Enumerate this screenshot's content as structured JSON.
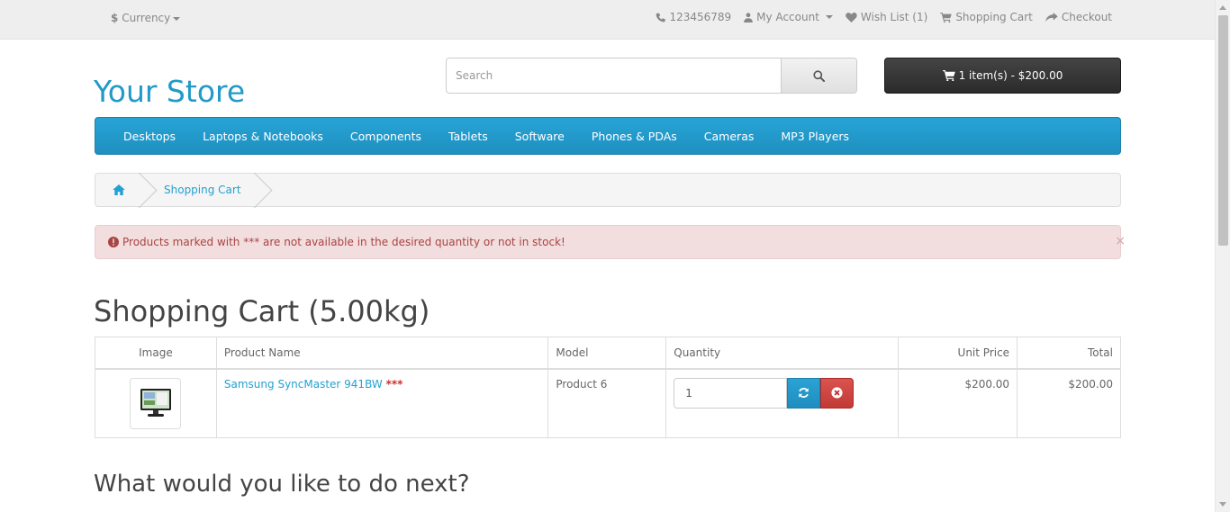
{
  "topbar": {
    "currency_symbol": "$",
    "currency_label": "Currency",
    "phone": "123456789",
    "my_account": "My Account",
    "wish_list": "Wish List (1)",
    "shopping_cart": "Shopping Cart",
    "checkout": "Checkout"
  },
  "header": {
    "logo": "Your Store",
    "search_placeholder": "Search",
    "cart_button": "1 item(s) - $200.00"
  },
  "menu": {
    "items": [
      "Desktops",
      "Laptops & Notebooks",
      "Components",
      "Tablets",
      "Software",
      "Phones & PDAs",
      "Cameras",
      "MP3 Players"
    ]
  },
  "breadcrumb": {
    "current": "Shopping Cart"
  },
  "alert": {
    "text": "Products marked with *** are not available in the desired quantity or not in stock!",
    "close": "×"
  },
  "page": {
    "title": "Shopping Cart  (5.00kg)",
    "next_heading": "What would you like to do next?"
  },
  "cart_table": {
    "headers": [
      "Image",
      "Product Name",
      "Model",
      "Quantity",
      "Unit Price",
      "Total"
    ],
    "rows": [
      {
        "product_name": "Samsung SyncMaster 941BW",
        "stock_flag": "***",
        "model": "Product 6",
        "quantity": "1",
        "unit_price": "$200.00",
        "total": "$200.00"
      }
    ]
  },
  "colors": {
    "brand_blue": "#229ac8",
    "menu_blue": "#229ac8",
    "alert_bg": "#f2dede",
    "alert_text": "#a94442",
    "danger": "#d9534f"
  }
}
